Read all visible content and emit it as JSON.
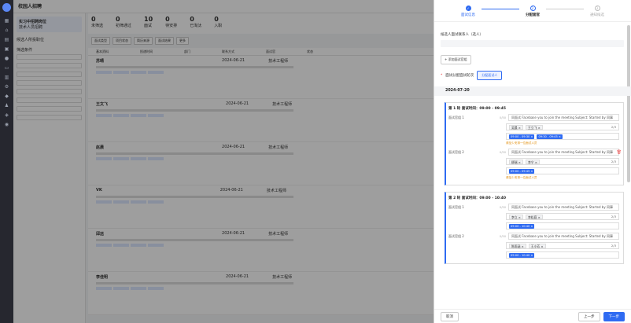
{
  "app": {
    "title": "校园人招聘"
  },
  "underlay": {
    "job": {
      "title": "实习中招聘岗位",
      "sub": "技术人员招聘"
    },
    "section": "候选人所投职位",
    "filter_title": "筛选条件",
    "stats": [
      {
        "n": "0",
        "l": "未筛选"
      },
      {
        "n": "0",
        "l": "初筛通过"
      },
      {
        "n": "10",
        "l": "面试"
      },
      {
        "n": "0",
        "l": "待安排"
      },
      {
        "n": "0",
        "l": "已淘汰"
      },
      {
        "n": "0",
        "l": "入职"
      }
    ],
    "chips": [
      "面试类型",
      "项目状态",
      "简历来源",
      "面试结果",
      "更多"
    ],
    "cols": [
      "基本资料",
      "投递时间",
      "部门",
      "联系方式",
      "面试官",
      "状态"
    ],
    "rows": [
      {
        "name": "苏晴",
        "date": "2024-06-21",
        "dept": "技术工程师"
      },
      {
        "name": "王文飞",
        "date": "2024-06-21",
        "dept": "技术工程师"
      },
      {
        "name": "赵晨",
        "date": "2024-06-21",
        "dept": "技术工程师"
      },
      {
        "name": "VK",
        "date": "2024-06-21",
        "dept": "技术工程师"
      },
      {
        "name": "邱远",
        "date": "2024-06-21",
        "dept": "技术工程师"
      },
      {
        "name": "李佳明",
        "date": "2024-06-21",
        "dept": "技术工程师"
      }
    ]
  },
  "drawer": {
    "steps": [
      {
        "icon": "✓",
        "label": "面试信息",
        "state": "done"
      },
      {
        "icon": "2",
        "label": "分配面官",
        "state": "active"
      },
      {
        "icon": "3",
        "label": "通知候选",
        "state": "todo"
      }
    ],
    "contact_label": "候选人面试联系人（选人）",
    "add_button": "+ 添加面试官组",
    "req_label": "面试分配面试轮次",
    "req_button": "分配面试人",
    "date": "2024-07-20",
    "cards": [
      {
        "title": "第 1 轮 面试时间：09:00 - 09:45",
        "groups": [
          {
            "label": "面试官组 1",
            "count": "0/50",
            "text": "同面试 Facebase you to join the meeting Subject: Started by 同事",
            "people": [
              "吴晨",
              "王立飞"
            ],
            "num": "2/3",
            "slots": [
              "09:00 - 09:30",
              "09:30 - 09:45"
            ],
            "hint": "请至少安排一位面试人员",
            "trash": false
          },
          {
            "label": "面试官组 2",
            "count": "0/50",
            "text": "同面试 Facebase you to join the meeting Subject: Started by 同事",
            "people": [
              "柳瑞",
              "李宁"
            ],
            "num": "2/3",
            "slots": [
              "09:00 - 09:45"
            ],
            "hint": "请至少安排一位面试人员",
            "trash": true
          }
        ]
      },
      {
        "title": "第 2 轮 面试时间：09:00 - 10:40",
        "groups": [
          {
            "label": "面试官组 1",
            "count": "0/50",
            "text": "同面试 Facebase you to join the meeting Subject: Started by 同事",
            "people": [
              "李立",
              "李松庭"
            ],
            "num": "2/3",
            "slots": [
              "09:00 - 10:40"
            ],
            "hint": "",
            "trash": false
          },
          {
            "label": "面试官组 2",
            "count": "0/50",
            "text": "同面试 Facebase you to join the meeting Subject: Started by 同事",
            "people": [
              "陈雨涵",
              "王小芳"
            ],
            "num": "2/3",
            "slots": [
              "09:00 - 10:40"
            ],
            "hint": "",
            "trash": false
          }
        ]
      }
    ],
    "footer": {
      "cancel": "取消",
      "prev": "上一步",
      "next": "下一步"
    }
  }
}
